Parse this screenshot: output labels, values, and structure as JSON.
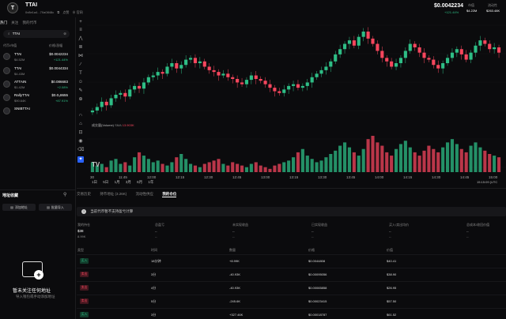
{
  "header": {
    "logo": "T",
    "token_name": "TTAI",
    "token_address": "0x8e1a4...70a0848c",
    "copy_icon": "copy-icon",
    "links": [
      "点赞",
      "官网"
    ],
    "price": "$0.0042234",
    "price_change": "+121.44%",
    "stats": [
      {
        "label": "市值",
        "value": "$4.22M"
      },
      {
        "label": "流动性",
        "value": "$263.48K"
      }
    ]
  },
  "left": {
    "tabs": [
      "热门",
      "关注",
      "我的代币"
    ],
    "search_value": "TTAI",
    "list_header": {
      "left": "代币/市值",
      "right": "价格/涨幅"
    },
    "watchlist": [
      {
        "name": "TTAI",
        "sub": "$4.52M",
        "price": "$0.0042234",
        "change": "+121.44%",
        "dir": "up"
      },
      {
        "name": "TTAI",
        "sub": "$4.43M",
        "price": "$0.0044334",
        "change": "",
        "dir": "up"
      },
      {
        "name": "ATTAIN",
        "sub": "$1.42M",
        "price": "$0.086683",
        "change": "+2.08%",
        "dir": "up"
      },
      {
        "name": "RallyTTAI",
        "sub": "$90.64K",
        "price": "$0.0₃8655",
        "change": "+87.91%",
        "dir": "up"
      },
      {
        "name": "SNIBTTAI",
        "sub": "",
        "price": "",
        "change": "",
        "dir": "up"
      }
    ],
    "address_box": {
      "title": "地址收藏",
      "btn_add": "添加地址",
      "btn_import": "批量导入",
      "empty_title": "暂未关注任何地址",
      "empty_sub": "导入钱包或手动添加地址"
    }
  },
  "chart": {
    "volume_label": "成交量(Volume)",
    "volume_ma": "SMA",
    "volume_value": "13.903K",
    "timeframes": [
      "1日",
      "5日",
      "1月",
      "3月",
      "6月",
      "1年"
    ],
    "clock": "15:15:09 (UTC",
    "x_ticks": [
      "30",
      "11:45",
      "12:00",
      "12:15",
      "12:30",
      "12:45",
      "13:00",
      "13:15",
      "13:30",
      "13:45",
      "14:00",
      "14:15",
      "14:30",
      "14:45",
      "15:00"
    ]
  },
  "chart_data": {
    "type": "bar",
    "title": "",
    "series": [
      {
        "name": "price",
        "values": [
          20,
          24,
          30,
          26,
          34,
          38,
          40,
          36,
          44,
          48,
          45,
          52,
          58,
          60,
          64,
          62,
          70,
          74,
          68,
          72,
          78,
          80,
          74,
          76,
          70,
          66,
          64,
          60,
          62,
          58,
          56,
          52,
          50,
          55,
          60,
          56,
          54,
          50,
          46,
          42,
          40,
          44,
          48,
          50,
          46,
          48,
          52,
          58,
          62,
          66,
          70,
          76,
          84,
          90,
          96,
          100,
          94,
          104,
          110,
          102,
          96,
          88,
          80,
          76,
          70,
          74,
          80,
          88,
          96,
          92,
          86,
          80,
          78,
          72,
          68,
          74,
          80,
          86,
          90,
          84,
          78,
          86,
          94,
          100,
          96,
          90,
          92,
          86
        ]
      },
      {
        "name": "volume",
        "values": [
          6,
          4,
          5,
          3,
          7,
          8,
          5,
          6,
          4,
          9,
          12,
          10,
          8,
          6,
          7,
          5,
          4,
          6,
          9,
          11,
          8,
          5,
          4,
          3,
          5,
          6,
          7,
          8,
          5,
          4,
          6,
          5,
          4,
          3,
          5,
          6,
          4,
          3,
          2,
          4,
          5,
          6,
          7,
          9,
          12,
          14,
          10,
          8,
          6,
          7,
          9,
          11,
          13,
          16,
          18,
          15,
          12,
          10,
          14,
          20,
          22,
          18,
          16,
          12,
          10,
          14,
          17,
          19,
          15,
          12,
          10,
          13,
          16,
          14,
          12,
          15,
          18,
          20,
          17,
          14,
          12,
          16,
          18,
          15,
          13,
          11,
          10,
          9
        ]
      }
    ]
  },
  "bottom": {
    "tabs": [
      "交易历史",
      "持币地址 (3.26K)",
      "流动性供应",
      "我的仓位"
    ],
    "active_tab": 3,
    "notice": "当前代币暂不支持盈亏计算",
    "summary": [
      {
        "label": "我的持仓",
        "value": "$38",
        "sub": "8.99K"
      },
      {
        "label": "总盈亏",
        "value": "--",
        "sub": "--"
      },
      {
        "label": "未实现收益",
        "value": "--",
        "sub": "--"
      },
      {
        "label": "已实现收益",
        "value": "--",
        "sub": "--"
      },
      {
        "label": "买入/卖出均价",
        "value": "--",
        "sub": "--"
      },
      {
        "label": "总成本/收回价值",
        "value": "--",
        "sub": "--"
      }
    ],
    "table_headers": [
      "类型",
      "时间",
      "数量",
      "价格",
      "价值"
    ],
    "rows": [
      {
        "type": "买入",
        "side": "buy",
        "time": "18分钟",
        "amount": "+8.99K",
        "price": "$0.0044808",
        "value": "$40.41"
      },
      {
        "type": "卖出",
        "side": "sell",
        "time": "3分",
        "amount": "-40.93K",
        "price": "$0.00095056",
        "value": "$38.90"
      },
      {
        "type": "卖出",
        "side": "sell",
        "time": "4分",
        "amount": "-40.93K",
        "price": "$0.00065858",
        "value": "$26.95"
      },
      {
        "type": "卖出",
        "side": "sell",
        "time": "5分",
        "amount": "-245.6K",
        "price": "$0.00023415",
        "value": "$57.50"
      },
      {
        "type": "买入",
        "side": "buy",
        "time": "3分",
        "amount": "+327.46K",
        "price": "$0.00018787",
        "value": "$61.52"
      }
    ]
  },
  "colors": {
    "up": "#2ebd85",
    "down": "#f6465d",
    "bg": "#0b0b0d"
  }
}
